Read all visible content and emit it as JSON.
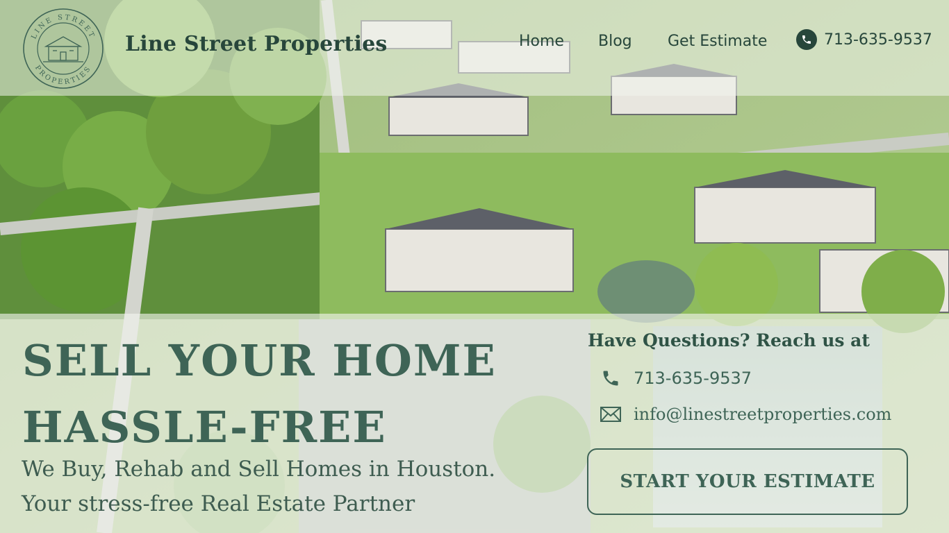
{
  "brand": {
    "name": "Line Street Properties",
    "logo_ring_top": "LINE STREET",
    "logo_ring_bottom": "PROPERTIES",
    "logo_icon": "house-icon"
  },
  "nav": {
    "items": [
      {
        "label": "Home"
      },
      {
        "label": "Blog"
      },
      {
        "label": "Get Estimate"
      }
    ],
    "phone": "713-635-9537",
    "phone_icon": "phone-icon"
  },
  "hero": {
    "headline_line1": "SELL YOUR HOME",
    "headline_line2": "HASSLE-FREE",
    "tagline_line1": "We Buy, Rehab and Sell Homes in Houston.",
    "tagline_line2": "Your stress-free Real Estate Partner"
  },
  "contact": {
    "heading": "Have Questions? Reach us at",
    "phone": "713-635-9537",
    "phone_icon": "phone-icon",
    "email": "info@linestreetproperties.com",
    "email_icon": "envelope-icon",
    "cta_label": "START YOUR ESTIMATE"
  },
  "colors": {
    "brand_green": "#3e6456",
    "dark_green": "#27463b"
  }
}
